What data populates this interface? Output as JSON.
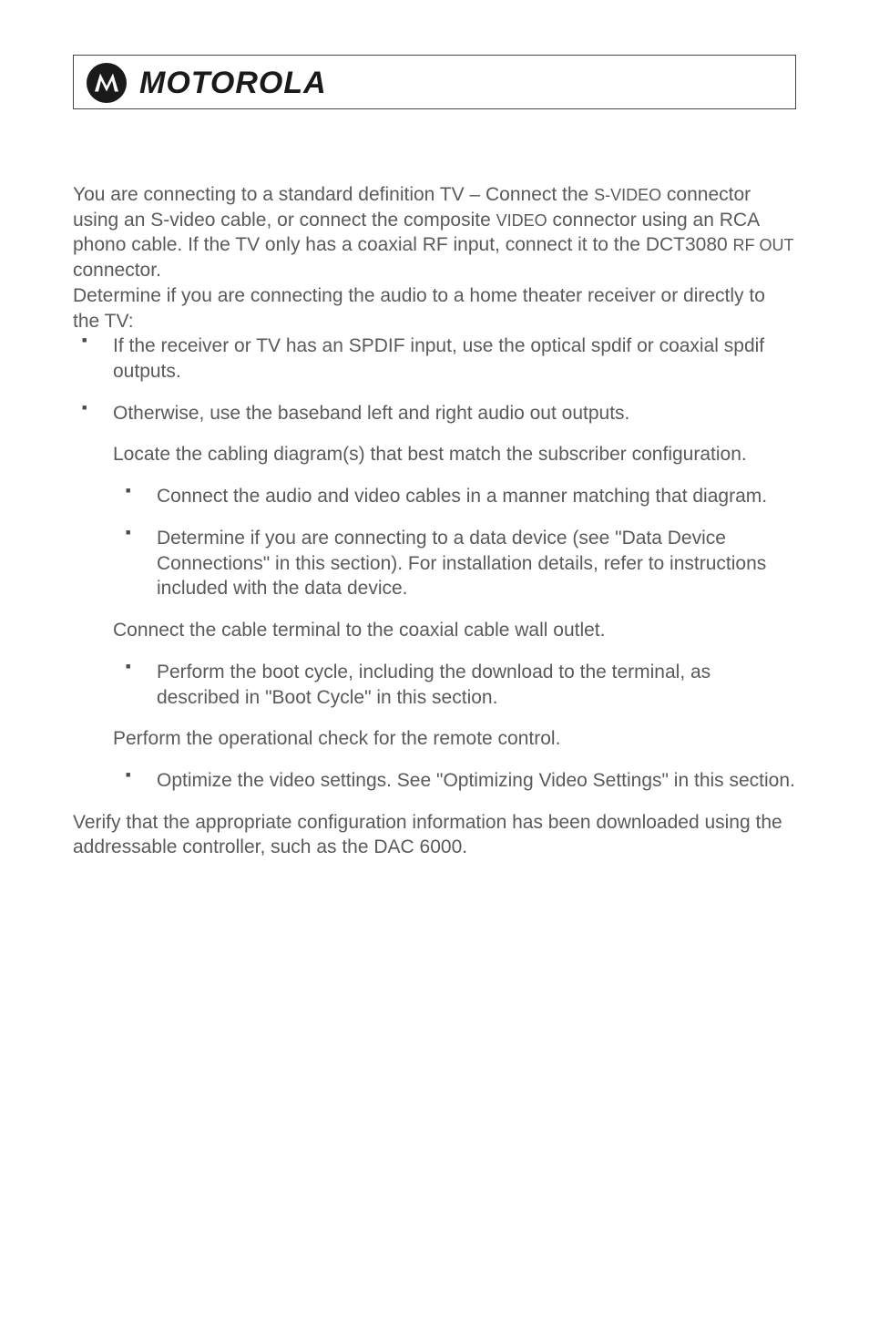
{
  "brand": "MOTOROLA",
  "para1_parts": [
    "You are connecting to a standard definition TV – Connect the ",
    "S-VIDEO",
    " connector using an S-video cable, or connect the composite ",
    "VIDEO",
    " connector using an RCA phono cable. If the TV only has a coaxial RF input, connect it to the DCT3080 ",
    "RF OUT",
    " connector."
  ],
  "para2": "Determine if you are connecting the audio to a home theater receiver or directly to the TV:",
  "bullets_top": [
    "If the receiver or TV has an SPDIF input, use the optical spdif or coaxial spdif outputs.",
    "Otherwise, use the baseband left and right audio out outputs."
  ],
  "para_locate": "Locate the cabling diagram(s) that best match the subscriber configuration.",
  "bullets_locate": [
    "Connect the audio and video cables in a manner matching that diagram.",
    "Determine if you are connecting to a data device (see \"Data Device Connections\" in this section). For installation details, refer to instructions included with the data device."
  ],
  "para_connect": "Connect the cable terminal to the coaxial cable wall outlet.",
  "bullets_connect": [
    "Perform the boot cycle, including the download to the terminal, as described in \"Boot Cycle\" in this section."
  ],
  "para_perform": "Perform the operational check for the remote control.",
  "bullets_perform": [
    "Optimize the video settings. See \"Optimizing Video Settings\" in this section."
  ],
  "para_verify": "Verify that the appropriate configuration information has been downloaded using the addressable controller, such as the DAC 6000."
}
